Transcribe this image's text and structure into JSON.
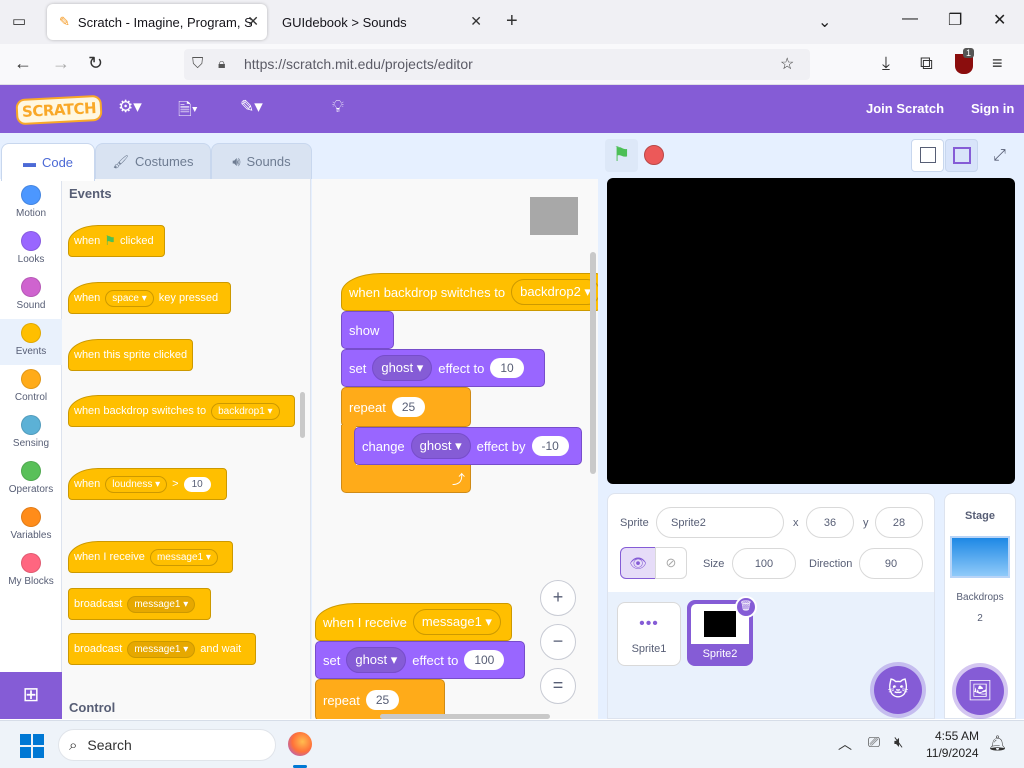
{
  "browser": {
    "tabs": [
      {
        "title": "Scratch - Imagine, Program, Sh",
        "active": true
      },
      {
        "title": "GUIdebook > Sounds",
        "active": false
      }
    ],
    "new_tab": "+",
    "url": "https://scratch.mit.edu/projects/editor",
    "extension_badge": "1"
  },
  "menubar": {
    "logo": "SCRATCH",
    "join": "Join Scratch",
    "signin": "Sign in"
  },
  "editor_tabs": [
    {
      "label": "Code",
      "icon": "code-icon"
    },
    {
      "label": "Costumes",
      "icon": "brush-icon"
    },
    {
      "label": "Sounds",
      "icon": "speaker-icon"
    }
  ],
  "categories": [
    {
      "label": "Motion",
      "color": "#4c97ff"
    },
    {
      "label": "Looks",
      "color": "#9966ff"
    },
    {
      "label": "Sound",
      "color": "#cf63cf"
    },
    {
      "label": "Events",
      "color": "#ffbf00",
      "selected": true
    },
    {
      "label": "Control",
      "color": "#ffab19"
    },
    {
      "label": "Sensing",
      "color": "#5cb1d6"
    },
    {
      "label": "Operators",
      "color": "#59c059"
    },
    {
      "label": "Variables",
      "color": "#ff8c1a"
    },
    {
      "label": "My Blocks",
      "color": "#ff6680"
    }
  ],
  "palette": {
    "events_heading": "Events",
    "control_heading": "Control",
    "blocks": {
      "flag_when": "when",
      "flag_clicked": "clicked",
      "key_when": "when",
      "key_value": "space",
      "key_pressed": "key pressed",
      "sprite_clicked": "when this sprite clicked",
      "backdrop_text": "when backdrop switches to",
      "backdrop_value": "backdrop1",
      "loud_when": "when",
      "loud_sensor": "loudness",
      "loud_gt": ">",
      "loud_value": "10",
      "receive_text": "when I receive",
      "receive_value": "message1",
      "broadcast_text": "broadcast",
      "broadcast_value": "message1",
      "broadcastwait_text": "broadcast",
      "broadcastwait_value": "message1",
      "broadcastwait_suffix": "and wait"
    }
  },
  "script1": {
    "hat_text": "when backdrop switches to",
    "hat_value": "backdrop2",
    "show": "show",
    "set_text": "set",
    "set_effect": "ghost",
    "set_suffix": "effect to",
    "set_value": "10",
    "repeat_text": "repeat",
    "repeat_value": "25",
    "change_text": "change",
    "change_effect": "ghost",
    "change_suffix": "effect by",
    "change_value": "-10"
  },
  "script2": {
    "hat_text": "when I receive",
    "hat_value": "message1",
    "set_text": "set",
    "set_effect": "ghost",
    "set_suffix": "effect to",
    "set_value": "100",
    "repeat_text": "repeat",
    "repeat_value": "25"
  },
  "zoom": {
    "in": "+",
    "out": "−",
    "reset": "="
  },
  "sprite_info": {
    "sprite_label": "Sprite",
    "sprite_name": "Sprite2",
    "x_label": "x",
    "x_value": "36",
    "y_label": "y",
    "y_value": "28",
    "size_label": "Size",
    "size_value": "100",
    "direction_label": "Direction",
    "direction_value": "90"
  },
  "sprites": [
    {
      "name": "Sprite1",
      "thumb": "•••"
    },
    {
      "name": "Sprite2",
      "selected": true
    }
  ],
  "stage_pane": {
    "title": "Stage",
    "backdrops_label": "Backdrops",
    "backdrops_count": "2"
  },
  "taskbar": {
    "search": "Search",
    "time": "4:55 AM",
    "date": "11/9/2024"
  }
}
